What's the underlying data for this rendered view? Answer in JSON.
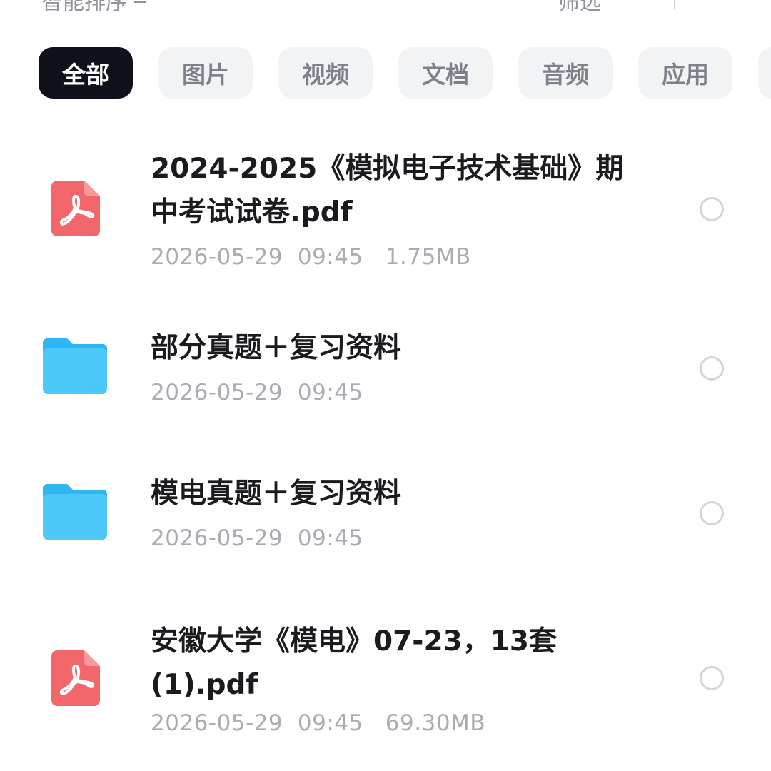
{
  "toolbar": {
    "sort_label": "智能排序",
    "filter_label": "筛选"
  },
  "chips": [
    {
      "label": "全部",
      "active": true
    },
    {
      "label": "图片",
      "active": false
    },
    {
      "label": "视频",
      "active": false
    },
    {
      "label": "文档",
      "active": false
    },
    {
      "label": "音频",
      "active": false
    },
    {
      "label": "应用",
      "active": false
    }
  ],
  "files": [
    {
      "type": "pdf",
      "name": "2024-2025《模拟电子技术基础》期中考试试卷.pdf",
      "date": "2026-05-29",
      "time": "09:45",
      "size": "1.75MB"
    },
    {
      "type": "folder",
      "name": "部分真题＋复习资料",
      "date": "2026-05-29",
      "time": "09:45",
      "size": ""
    },
    {
      "type": "folder",
      "name": "模电真题＋复习资料",
      "date": "2026-05-29",
      "time": "09:45",
      "size": ""
    },
    {
      "type": "pdf",
      "name": "安徽大学《模电》07-23，13套(1).pdf",
      "date": "2026-05-29",
      "time": "09:45",
      "size": "69.30MB"
    }
  ],
  "colors": {
    "pdf_red": "#f2676b",
    "folder_blue": "#3fc3f7",
    "active_chip": "#0f111a"
  }
}
